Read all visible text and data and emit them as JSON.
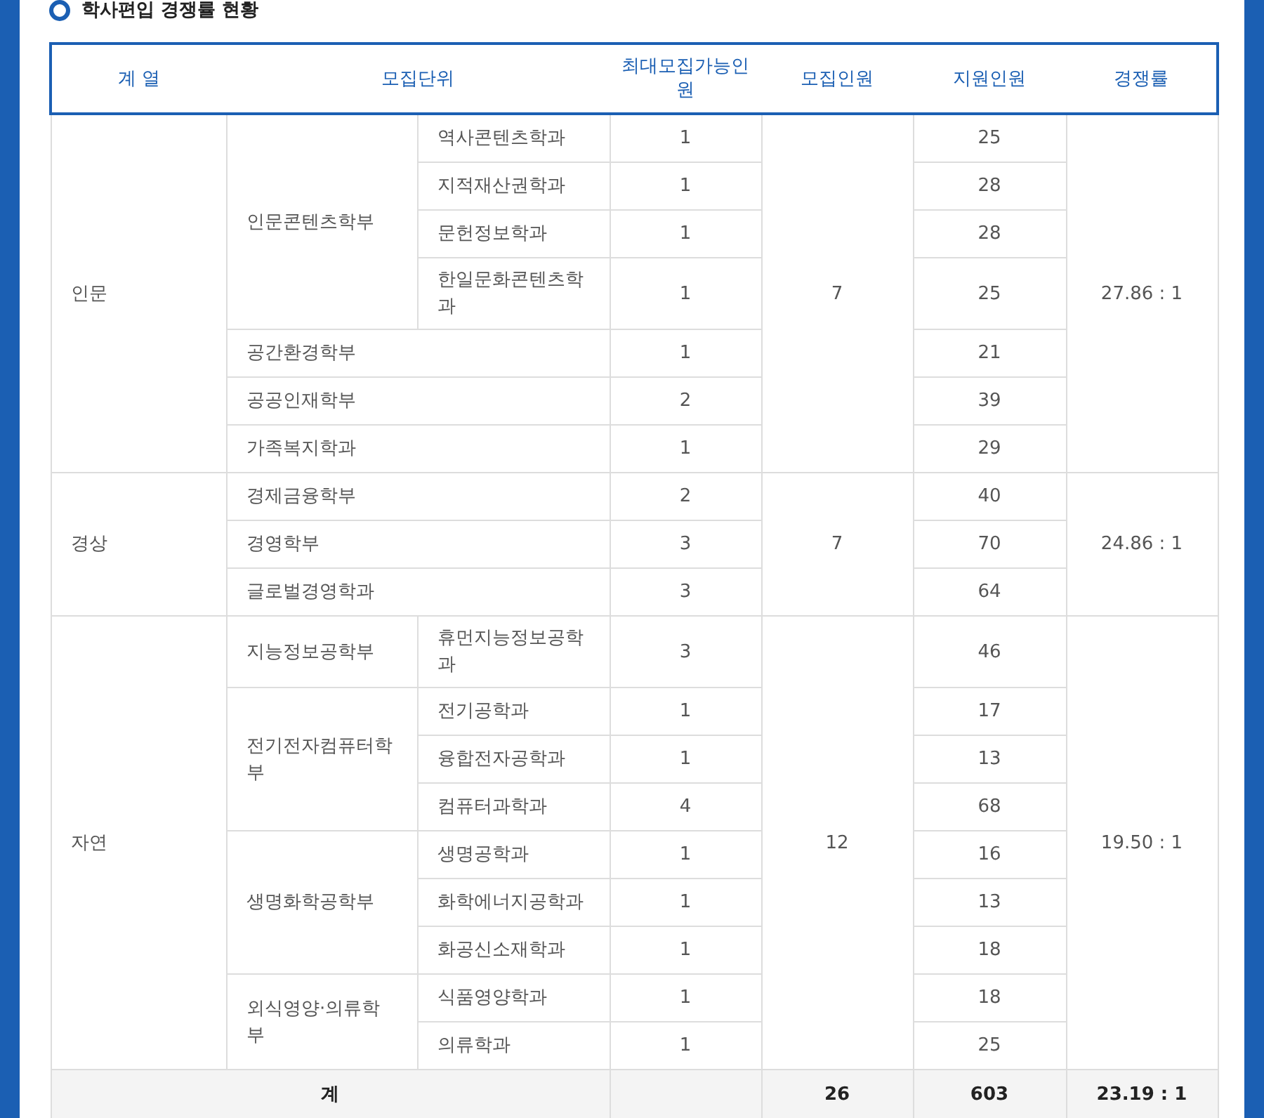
{
  "title": "학사편입 경쟁률 현황",
  "table": {
    "columns": [
      "계 열",
      "모집단위",
      "최대모집가능인원",
      "모집인원",
      "지원인원",
      "경쟁률"
    ],
    "groups": [
      {
        "name": "인문",
        "recruit": "7",
        "ratio": "27.86 : 1",
        "units": [
          {
            "name": "인문콘텐츠학부",
            "majors": [
              {
                "name": "역사콘텐츠학과",
                "max": "1",
                "applicants": "25"
              },
              {
                "name": "지적재산권학과",
                "max": "1",
                "applicants": "28"
              },
              {
                "name": "문헌정보학과",
                "max": "1",
                "applicants": "28"
              },
              {
                "name": "한일문화콘텐츠학과",
                "max": "1",
                "applicants": "25"
              }
            ]
          },
          {
            "name": "공간환경학부",
            "max": "1",
            "applicants": "21"
          },
          {
            "name": "공공인재학부",
            "max": "2",
            "applicants": "39"
          },
          {
            "name": "가족복지학과",
            "max": "1",
            "applicants": "29"
          }
        ]
      },
      {
        "name": "경상",
        "recruit": "7",
        "ratio": "24.86 : 1",
        "units": [
          {
            "name": "경제금융학부",
            "max": "2",
            "applicants": "40"
          },
          {
            "name": "경영학부",
            "max": "3",
            "applicants": "70"
          },
          {
            "name": "글로벌경영학과",
            "max": "3",
            "applicants": "64"
          }
        ]
      },
      {
        "name": "자연",
        "recruit": "12",
        "ratio": "19.50 : 1",
        "units": [
          {
            "name": "지능정보공학부",
            "majors": [
              {
                "name": "휴먼지능정보공학과",
                "max": "3",
                "applicants": "46"
              }
            ]
          },
          {
            "name": "전기전자컴퓨터학부",
            "majors": [
              {
                "name": "전기공학과",
                "max": "1",
                "applicants": "17"
              },
              {
                "name": "융합전자공학과",
                "max": "1",
                "applicants": "13"
              },
              {
                "name": "컴퓨터과학과",
                "max": "4",
                "applicants": "68"
              }
            ]
          },
          {
            "name": "생명화학공학부",
            "majors": [
              {
                "name": "생명공학과",
                "max": "1",
                "applicants": "16"
              },
              {
                "name": "화학에너지공학과",
                "max": "1",
                "applicants": "13"
              },
              {
                "name": "화공신소재학과",
                "max": "1",
                "applicants": "18"
              }
            ]
          },
          {
            "name": "외식영양·의류학부",
            "majors": [
              {
                "name": "식품영양학과",
                "max": "1",
                "applicants": "18"
              },
              {
                "name": "의류학과",
                "max": "1",
                "applicants": "25"
              }
            ]
          }
        ]
      }
    ],
    "total": {
      "label": "계",
      "recruit": "26",
      "applicants": "603",
      "ratio": "23.19 : 1"
    }
  }
}
